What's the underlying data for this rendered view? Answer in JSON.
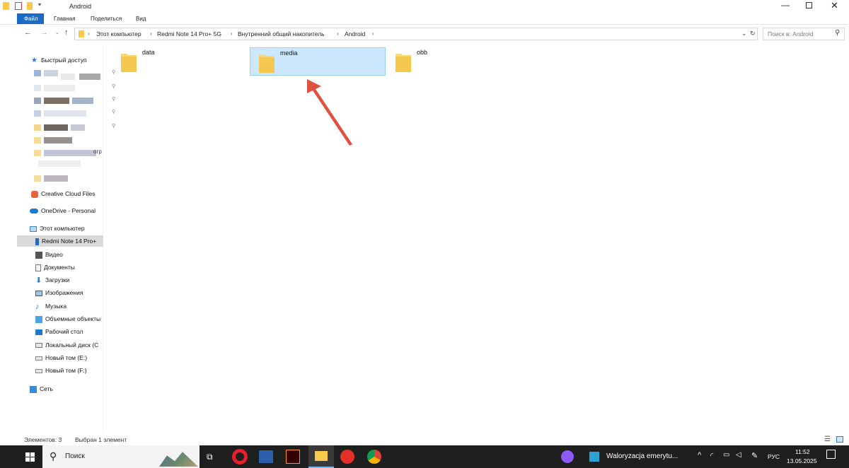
{
  "window": {
    "title": "Android",
    "tabs": [
      "Файл",
      "Главная",
      "Поделиться",
      "Вид"
    ]
  },
  "address": {
    "crumbs": [
      "Этот компьютер",
      "Redmi Note 14 Pro+ 5G",
      "Внутренний общий накопитель",
      "Android"
    ],
    "search_placeholder": "Поиск в: Android"
  },
  "nav": {
    "quick_access": "Быстрый доступ",
    "pinned_partial_label": "огр",
    "creative_cloud": "Creative Cloud Files",
    "onedrive": "OneDrive - Personal",
    "this_pc": "Этот компьютер",
    "items": [
      "Redmi Note 14 Pro+",
      "Видео",
      "Документы",
      "Загрузки",
      "Изображения",
      "Музыка",
      "Объемные объекты",
      "Рабочий стол",
      "Локальный диск (C",
      "Новый том (E:)",
      "Новый том (F:)"
    ],
    "network": "Сеть"
  },
  "folders": [
    {
      "name": "data",
      "selected": false
    },
    {
      "name": "media",
      "selected": true
    },
    {
      "name": "obb",
      "selected": false
    }
  ],
  "status": {
    "count": "Элементов: 3",
    "selected": "Выбран 1 элемент"
  },
  "taskbar": {
    "search": "Поиск",
    "active_window": "Waloryzacja emerytu...",
    "lang": "РУС",
    "time": "11:52",
    "date": "13.05.2025"
  },
  "colors": {
    "accent": "#1a6bc7",
    "selection": "#cce8ff",
    "folder": "#f8d775",
    "annotation_arrow": "#e0513f"
  }
}
